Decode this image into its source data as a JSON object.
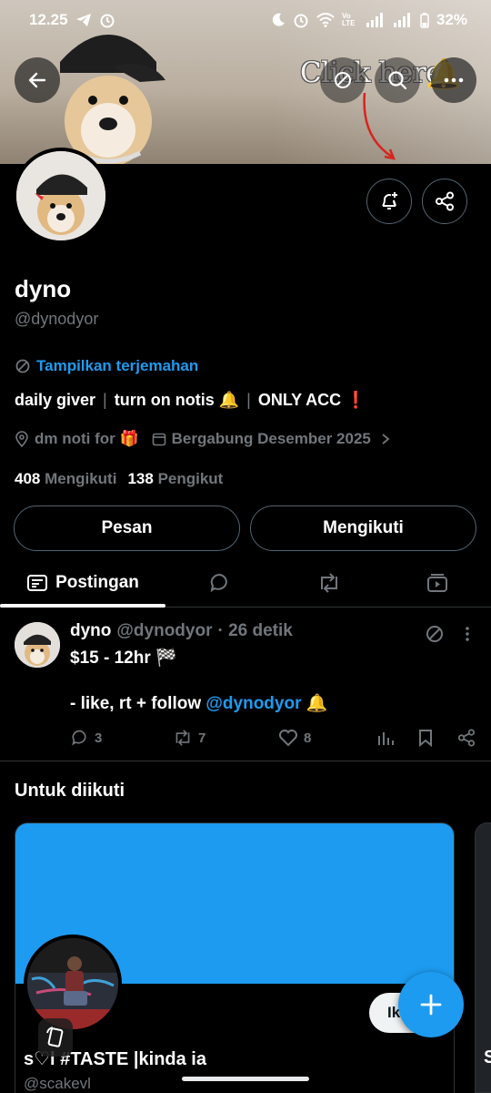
{
  "status_bar": {
    "time": "12.25",
    "battery": "32%",
    "network_label": "Vo LTE"
  },
  "banner_overlay": {
    "text": "Click here",
    "bell": "🔔"
  },
  "profile": {
    "name": "dyno",
    "handle": "@dynodyor",
    "translate_label": "Tampilkan terjemahan",
    "bio": [
      "daily giver",
      "turn on notis 🔔",
      "ONLY ACC ❗"
    ],
    "bio_separator": "|",
    "location": "dm noti for 🎁",
    "joined": "Bergabung Desember 2025",
    "following_count": "408",
    "following_label": "Mengikuti",
    "followers_count": "138",
    "followers_label": "Pengikut",
    "message_button": "Pesan",
    "following_button": "Mengikuti"
  },
  "tabs": {
    "active_label": "Postingan"
  },
  "tweet": {
    "name": "dyno",
    "handle": "@dynodyor",
    "time": "· 26 detik",
    "line1": "$15 - 12hr 🏁",
    "line2_prefix": "- like, rt + follow ",
    "line2_mention": "@dynodyor",
    "line2_suffix": " 🔔",
    "replies": "3",
    "reposts": "7",
    "likes": "8"
  },
  "suggestions": {
    "title": "Untuk diikuti",
    "card_name": "s♡l #TASTE |kinda ia",
    "card_handle": "@scakevl",
    "follow_label": "Ik",
    "next_card_letter": "S"
  },
  "colors": {
    "accent": "#1d9bf0",
    "muted": "#71767b",
    "border": "#2f3336",
    "background": "#000000"
  }
}
